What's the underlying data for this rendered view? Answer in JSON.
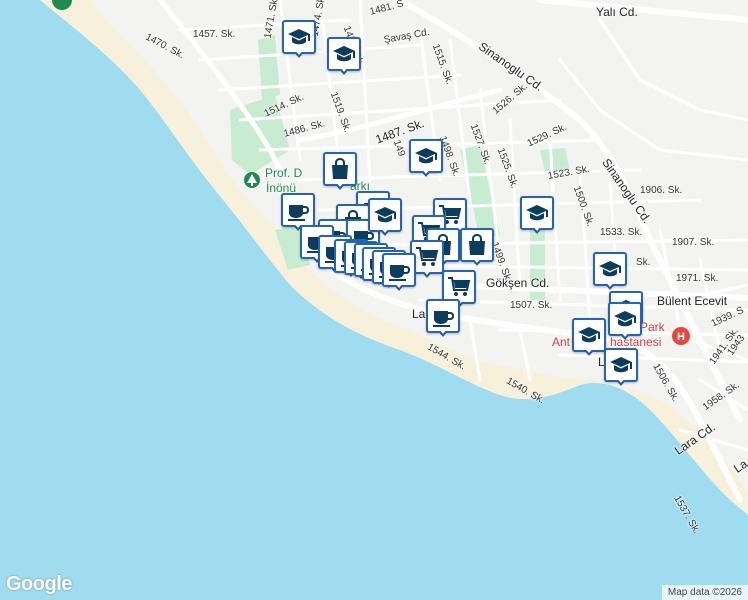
{
  "map": {
    "streets": [
      {
        "id": "s-yali",
        "text": "Yalı Cd."
      },
      {
        "id": "s-1457",
        "text": "1457. Sk."
      },
      {
        "id": "s-1470",
        "text": "1470. Sk."
      },
      {
        "id": "s-1471",
        "text": "1471. Sk."
      },
      {
        "id": "s-1474",
        "text": "1474. Sk."
      },
      {
        "id": "s-1475",
        "text": "1475. Sk."
      },
      {
        "id": "s-1481",
        "text": "1481. S"
      },
      {
        "id": "s-savas",
        "text": "Şavaş Cd."
      },
      {
        "id": "s-1515",
        "text": "1515. Sk."
      },
      {
        "id": "s-sinan1",
        "text": "Sinanoglu Cd."
      },
      {
        "id": "s-1514",
        "text": "1514. Sk."
      },
      {
        "id": "s-1519",
        "text": "1519. Sk."
      },
      {
        "id": "s-1486",
        "text": "1486. Sk."
      },
      {
        "id": "s-1487",
        "text": "1487. Sk."
      },
      {
        "id": "s-1526",
        "text": "1526. Sk."
      },
      {
        "id": "s-1529",
        "text": "1529. Sk."
      },
      {
        "id": "s-1527",
        "text": "1527. Sk."
      },
      {
        "id": "s-1525",
        "text": "1525. Sk."
      },
      {
        "id": "s-1498",
        "text": "1498. Sk."
      },
      {
        "id": "s-149x",
        "text": "149"
      },
      {
        "id": "s-sinan2",
        "text": "Sinanoglu Cd."
      },
      {
        "id": "s-1523",
        "text": "1523. Sk."
      },
      {
        "id": "s-1906",
        "text": "1906. Sk."
      },
      {
        "id": "s-1500",
        "text": "1500. Sk."
      },
      {
        "id": "s-1533",
        "text": "1533. Sk."
      },
      {
        "id": "s-1907",
        "text": "1907. Sk."
      },
      {
        "id": "s-1499",
        "text": "1499. Sk."
      },
      {
        "id": "s-sk",
        "text": "Sk."
      },
      {
        "id": "s-1971",
        "text": "1971. Sk."
      },
      {
        "id": "s-goksen",
        "text": "Gökşen Cd."
      },
      {
        "id": "s-bulent",
        "text": "Bülent Ecevit"
      },
      {
        "id": "s-1507",
        "text": "1507. Sk."
      },
      {
        "id": "s-1939",
        "text": "1939. S"
      },
      {
        "id": "s-lara1",
        "text": "Lara Cd."
      },
      {
        "id": "s-lar",
        "text": "Lar"
      },
      {
        "id": "s-1544",
        "text": "1544. Sk."
      },
      {
        "id": "s-1540",
        "text": "1540. Sk."
      },
      {
        "id": "s-1506",
        "text": "1506. Sk."
      },
      {
        "id": "s-1941",
        "text": "1941. Sk."
      },
      {
        "id": "s-1943",
        "text": "1943"
      },
      {
        "id": "s-1958",
        "text": "1958. Sk."
      },
      {
        "id": "s-lara2",
        "text": "Lara Cd."
      },
      {
        "id": "s-1537",
        "text": "1537. Sk."
      },
      {
        "id": "s-la",
        "text": "La"
      }
    ],
    "places": [
      {
        "id": "p-prof",
        "text": "Prof. D"
      },
      {
        "id": "p-inonu",
        "text": "İnönü"
      },
      {
        "id": "p-arki",
        "text": "arkı"
      },
      {
        "id": "p-park",
        "text": "Park"
      },
      {
        "id": "p-ant",
        "text": "Ant"
      },
      {
        "id": "p-hast",
        "text": "hastanesi"
      }
    ],
    "markers": [
      {
        "type": "school",
        "icon": "graduation-cap-icon"
      },
      {
        "type": "school",
        "icon": "graduation-cap-icon"
      },
      {
        "type": "school",
        "icon": "graduation-cap-icon"
      },
      {
        "type": "shopping",
        "icon": "shopping-bag-icon"
      },
      {
        "type": "cafe",
        "icon": "coffee-cup-icon"
      },
      {
        "type": "cafe",
        "icon": "coffee-cup-icon"
      },
      {
        "type": "grocery",
        "icon": "shopping-cart-icon"
      },
      {
        "type": "shopping",
        "icon": "shopping-bag-icon"
      },
      {
        "type": "cafe",
        "icon": "coffee-cup-icon"
      },
      {
        "type": "cafe",
        "icon": "coffee-cup-icon"
      },
      {
        "type": "cafe",
        "icon": "coffee-cup-icon"
      },
      {
        "type": "grocery",
        "icon": "shopping-cart-icon"
      },
      {
        "type": "shopping",
        "icon": "shopping-bag-icon"
      },
      {
        "type": "shopping",
        "icon": "shopping-bag-icon"
      },
      {
        "type": "grocery",
        "icon": "shopping-cart-icon"
      },
      {
        "type": "cafe",
        "icon": "coffee-cup-icon"
      },
      {
        "type": "cafe",
        "icon": "coffee-cup-icon"
      },
      {
        "type": "cafe",
        "icon": "coffee-cup-icon"
      },
      {
        "type": "cafe",
        "icon": "coffee-cup-icon"
      },
      {
        "type": "cafe",
        "icon": "coffee-cup-icon"
      },
      {
        "type": "cafe",
        "icon": "coffee-cup-icon"
      },
      {
        "type": "cafe",
        "icon": "coffee-cup-icon"
      },
      {
        "type": "grocery",
        "icon": "shopping-cart-icon"
      },
      {
        "type": "cafe",
        "icon": "coffee-cup-icon"
      },
      {
        "type": "school",
        "icon": "graduation-cap-icon"
      },
      {
        "type": "school",
        "icon": "graduation-cap-icon"
      },
      {
        "type": "school",
        "icon": "graduation-cap-icon"
      },
      {
        "type": "school",
        "icon": "graduation-cap-icon"
      },
      {
        "type": "school",
        "icon": "graduation-cap-icon"
      },
      {
        "type": "school",
        "icon": "graduation-cap-icon"
      },
      {
        "type": "school",
        "icon": "graduation-cap-icon"
      }
    ]
  },
  "footer": {
    "logo": "Google",
    "attribution": "Map data ©2026"
  },
  "colors": {
    "water": "#9fdcf0",
    "land": "#f3f3f1",
    "beach": "#f7f1dc",
    "park": "#c8ecd1",
    "road": "#ffffff",
    "marker_border": "#2463b5",
    "icon": "#0c3d5e",
    "hospital": "#e4473f"
  }
}
